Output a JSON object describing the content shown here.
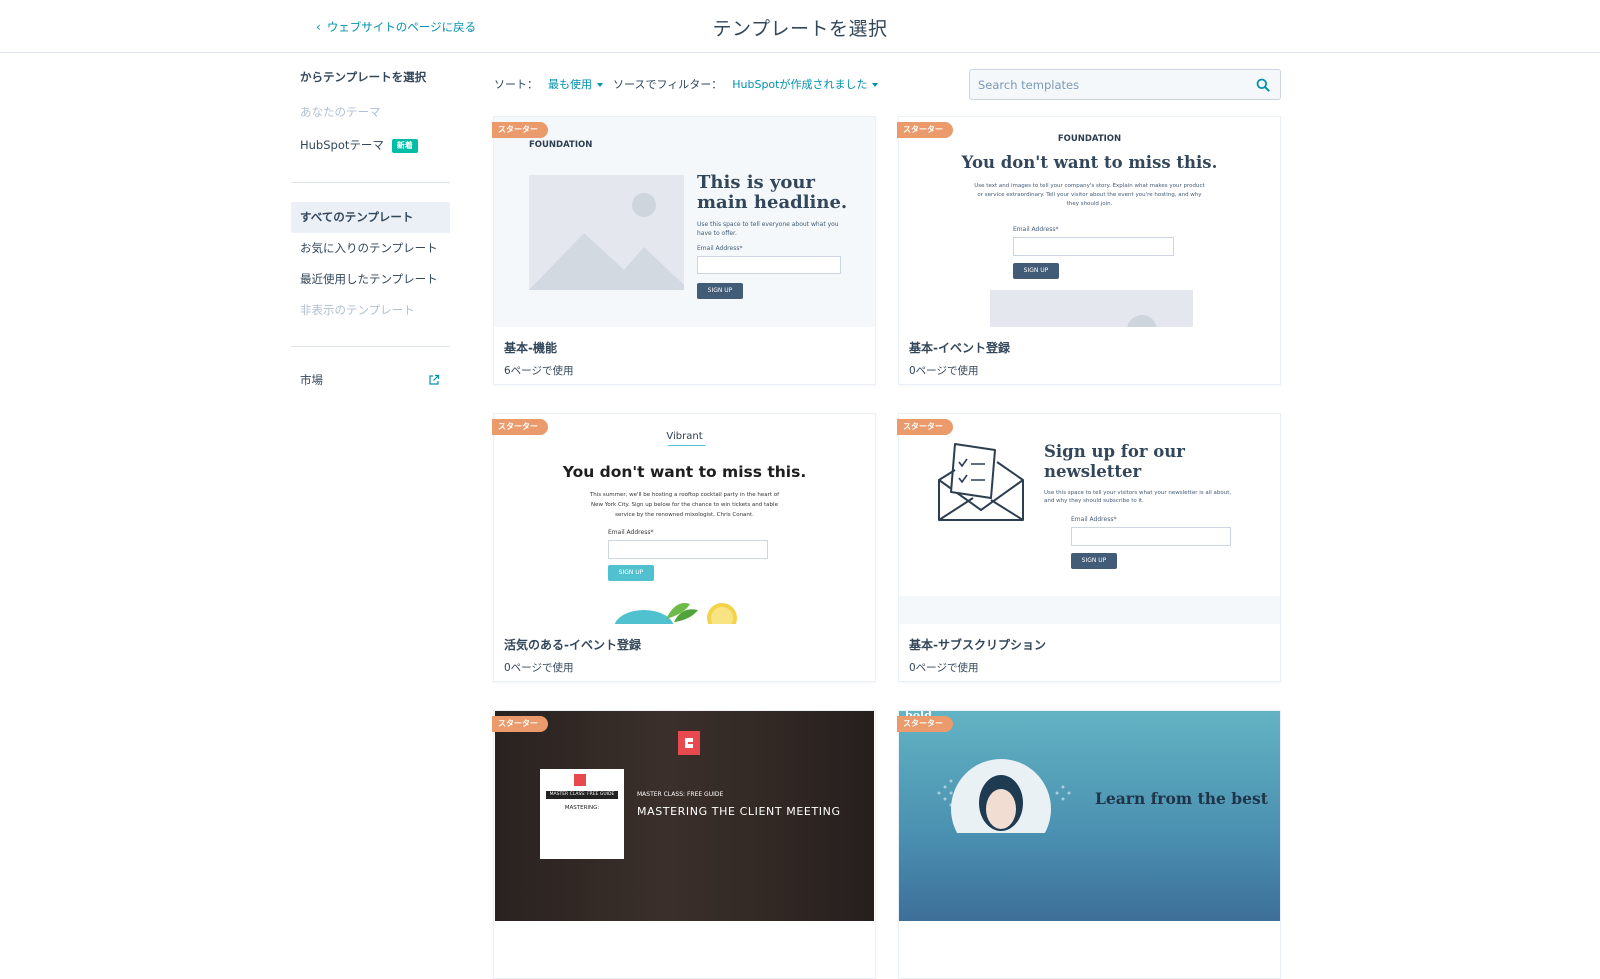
{
  "header": {
    "back_label": "ウェブサイトのページに戻る",
    "title": "テンプレートを選択"
  },
  "sidebar": {
    "heading": "からテンプレートを選択",
    "sources": [
      {
        "label": "あなたのテーマ"
      },
      {
        "label": "HubSpotテーマ",
        "badge": "新着"
      }
    ],
    "views": [
      {
        "label": "すべてのテンプレート"
      },
      {
        "label": "お気に入りのテンプレート"
      },
      {
        "label": "最近使用したテンプレート"
      },
      {
        "label": "非表示のテンプレート"
      }
    ],
    "marketplace_label": "市場"
  },
  "filters": {
    "sort_label": "ソート：",
    "sort_value": "最も使用",
    "source_label": "ソースでフィルター：",
    "source_value": "HubSpotが作成されました"
  },
  "search": {
    "placeholder": "Search templates"
  },
  "cards": [
    {
      "badge": "スターター",
      "name": "基本-機能",
      "usage": "6ページで使用",
      "preview": {
        "logo": "FOUNDATION",
        "headline_1": "This is your",
        "headline_2": "main headline.",
        "body_1": "Use this space to tell everyone about what you",
        "body_2": "have to offer.",
        "field_label": "Email Address*",
        "button": "SIGN UP"
      }
    },
    {
      "badge": "スターター",
      "name": "基本-イベント登録",
      "usage": "0ページで使用",
      "preview": {
        "logo": "FOUNDATION",
        "headline": "You don't want to miss this.",
        "body_1": "Use text and images to tell your company's story. Explain what makes your product",
        "body_2": "or service extraordinary. Tell your visitor about the event you're hosting, and why",
        "body_3": "they should join.",
        "field_label": "Email Address*",
        "button": "SIGN UP"
      }
    },
    {
      "badge": "スターター",
      "name": "活気のある-イベント登録",
      "usage": "0ページで使用",
      "preview": {
        "logo": "Vibrant",
        "headline": "You don't want to miss this.",
        "body_1": "This summer, we'll be hosting a rooftop cocktail party in the heart of",
        "body_2": "New York City. Sign up below for the chance to win tickets and table",
        "body_3": "service by the renowned mixologist, Chris Conant.",
        "field_label": "Email Address*",
        "button": "SIGN UP"
      }
    },
    {
      "badge": "スターター",
      "name": "基本-サブスクリプション",
      "usage": "0ページで使用",
      "preview": {
        "headline_1": "Sign up for our",
        "headline_2": "newsletter",
        "body_1": "Use this space to tell your visitors what your newsletter is all about,",
        "body_2": "and why they should subscribe to it.",
        "field_label": "Email Address*",
        "button": "SIGN UP"
      }
    },
    {
      "badge": "スターター",
      "preview": {
        "book_label": "MASTER CLASS: FREE GUIDE",
        "book_title": "MASTERING:",
        "kicker": "MASTER CLASS: FREE GUIDE",
        "headline": "MASTERING THE CLIENT MEETING"
      }
    },
    {
      "badge": "スターター",
      "preview": {
        "corner_text": "bold",
        "headline": "Learn from the best"
      }
    }
  ],
  "colors": {
    "link": "#0091ae",
    "text": "#33475b",
    "badge_starter": "#ea9a6b",
    "badge_new": "#00bda5",
    "active_bg": "#eaf0f6"
  }
}
